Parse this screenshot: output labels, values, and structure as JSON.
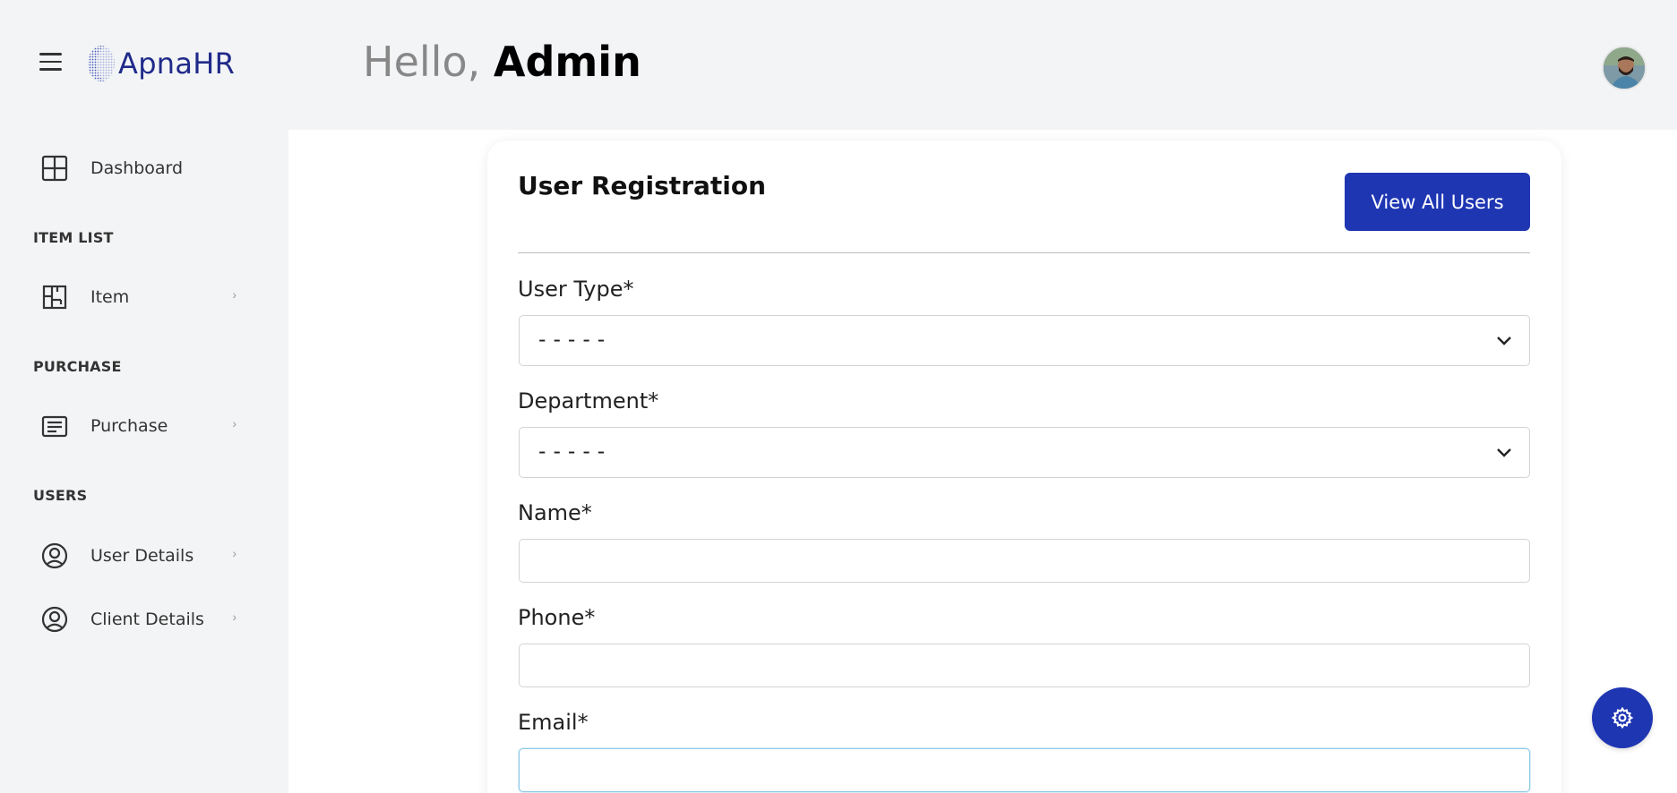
{
  "header": {
    "brand": "ApnaHR",
    "greeting_prefix": "Hello,",
    "greeting_name": "Admin"
  },
  "sidebar": {
    "items": [
      {
        "label": "Dashboard",
        "icon": "dashboard-grid-icon"
      },
      {
        "label": "Item",
        "icon": "floorplan-icon"
      },
      {
        "label": "Purchase",
        "icon": "receipt-icon"
      },
      {
        "label": "User Details",
        "icon": "user-circle-icon"
      },
      {
        "label": "Client Details",
        "icon": "user-circle-icon"
      }
    ],
    "sections": [
      "ITEM LIST",
      "PURCHASE",
      "USERS"
    ],
    "chevron": "›"
  },
  "form": {
    "title": "User Registration",
    "view_all_button": "View All Users",
    "user_type": {
      "label": "User Type*",
      "value": "-----"
    },
    "department": {
      "label": "Department*",
      "value": "-----"
    },
    "name": {
      "label": "Name*",
      "value": ""
    },
    "phone": {
      "label": "Phone*",
      "value": ""
    },
    "email": {
      "label": "Email*",
      "value": ""
    }
  },
  "colors": {
    "primary": "#1f36b3",
    "brand_text": "#1f2a8a",
    "background": "#f3f4f6"
  }
}
